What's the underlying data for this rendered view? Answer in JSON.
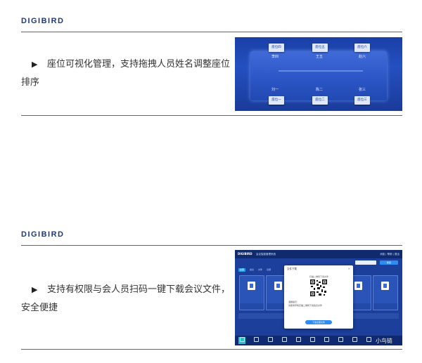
{
  "section1": {
    "brand": "DIGIBIRD",
    "feature_text": "座位可视化管理，支持拖拽人员姓名调整座位排序",
    "bullet": "▶",
    "seat_screen": {
      "top_seats": [
        "座位四",
        "座位五",
        "座位六"
      ],
      "upper_names": [
        "李四",
        "王五",
        "赵六"
      ],
      "lower_names": [
        "刘一",
        "陈二",
        "张三"
      ],
      "bottom_seats": [
        "座位一",
        "座位二",
        "座位三"
      ]
    }
  },
  "section2": {
    "brand": "DIGIBIRD",
    "feature_text": "支持有权限与会人员扫码一键下载会议文件，安全便捷",
    "bullet": "▶",
    "app_screen": {
      "logo": "DIGIBIRD",
      "system_name": "会议智能管理系统",
      "user_menu": "消息 | 帮助 | 退出",
      "new_button": "新建",
      "tabs": [
        "全部",
        "会议",
        "文件",
        "议题"
      ],
      "dialog": {
        "title": "文件下载",
        "hint": "扫描二维码下载文件",
        "note_line1": "温馨提示：",
        "note_line2": "请使用手机扫描二维码下载会议文件",
        "button": "下载全部文件"
      }
    }
  },
  "watermark": "小鸟链"
}
